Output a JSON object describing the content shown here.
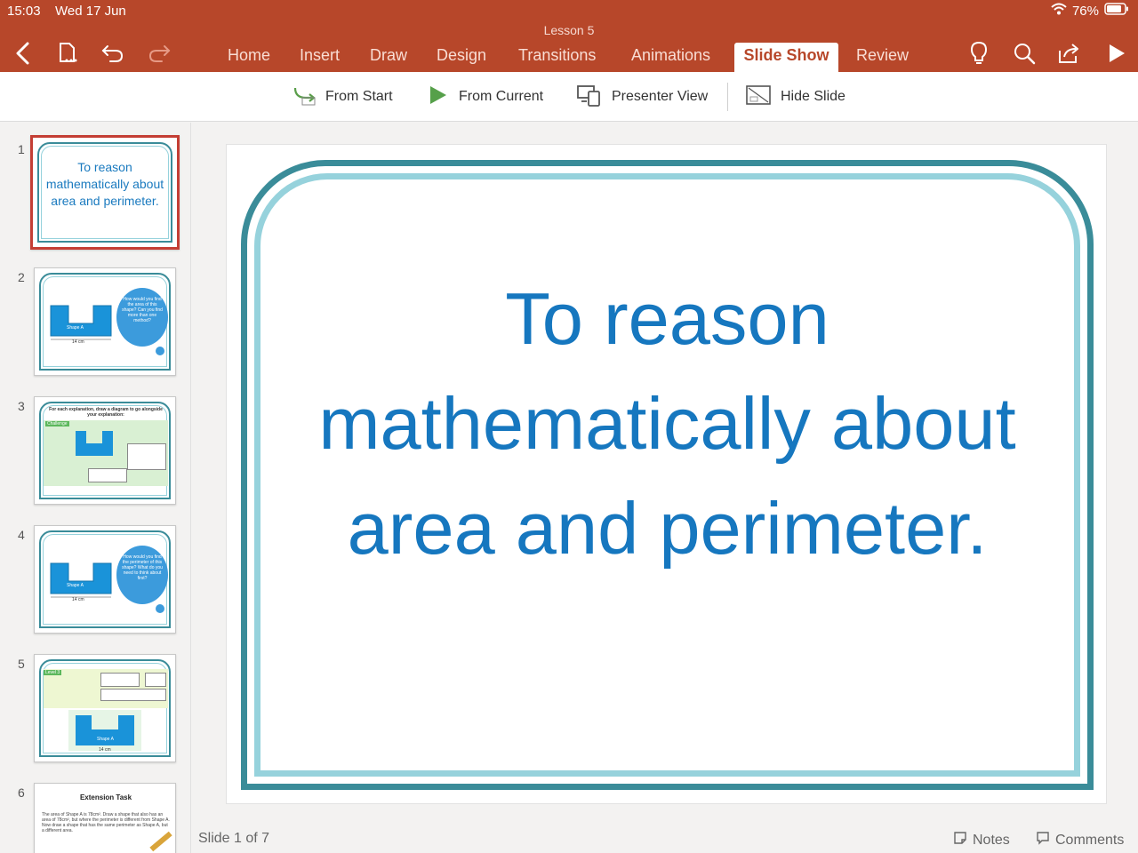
{
  "status_bar": {
    "time": "15:03",
    "date": "Wed 17 Jun",
    "battery": "76%"
  },
  "document_title": "Lesson 5",
  "tabs": [
    {
      "label": "Home"
    },
    {
      "label": "Insert"
    },
    {
      "label": "Draw"
    },
    {
      "label": "Design"
    },
    {
      "label": "Transitions"
    },
    {
      "label": "Animations"
    },
    {
      "label": "Slide Show",
      "active": true
    },
    {
      "label": "Review"
    }
  ],
  "ribbon": {
    "from_start": "From Start",
    "from_current": "From Current",
    "presenter_view": "Presenter View",
    "hide_slide": "Hide Slide"
  },
  "thumbnails": [
    {
      "number": "1",
      "text": "To reason mathematically about area and perimeter."
    },
    {
      "number": "2",
      "bubble": "How would you find the area of this shape? Can you find more than one method?",
      "shape_label": "Shape A",
      "dim": "14 cm"
    },
    {
      "number": "3",
      "heading": "For each explanation, draw a diagram to go alongside your explanation:",
      "tag": "Challenge"
    },
    {
      "number": "4",
      "bubble": "How would you find the perimeter of this shape? What do you need to think about first?",
      "shape_label": "Shape A",
      "dim": "14 cm"
    },
    {
      "number": "5",
      "tag": "Level 3",
      "shape_label": "Shape A",
      "dim": "14 cm"
    },
    {
      "number": "6",
      "heading": "Extension Task",
      "body": "The area of Shape A is 78cm². Draw a shape that also has an area of 78cm², but where the perimeter is different from Shape A. Now draw a shape that has the same perimeter as Shape A, but a different area."
    }
  ],
  "slide": {
    "text": "To reason mathematically about area and perimeter."
  },
  "footer": {
    "slide_count": "Slide 1 of 7",
    "notes": "Notes",
    "comments": "Comments"
  },
  "colors": {
    "header_red": "#b7472a",
    "slide_text_blue": "#1677bf",
    "frame_dark": "#3a8c99",
    "frame_light": "#96d2dc",
    "selection_red": "#c43e34"
  }
}
